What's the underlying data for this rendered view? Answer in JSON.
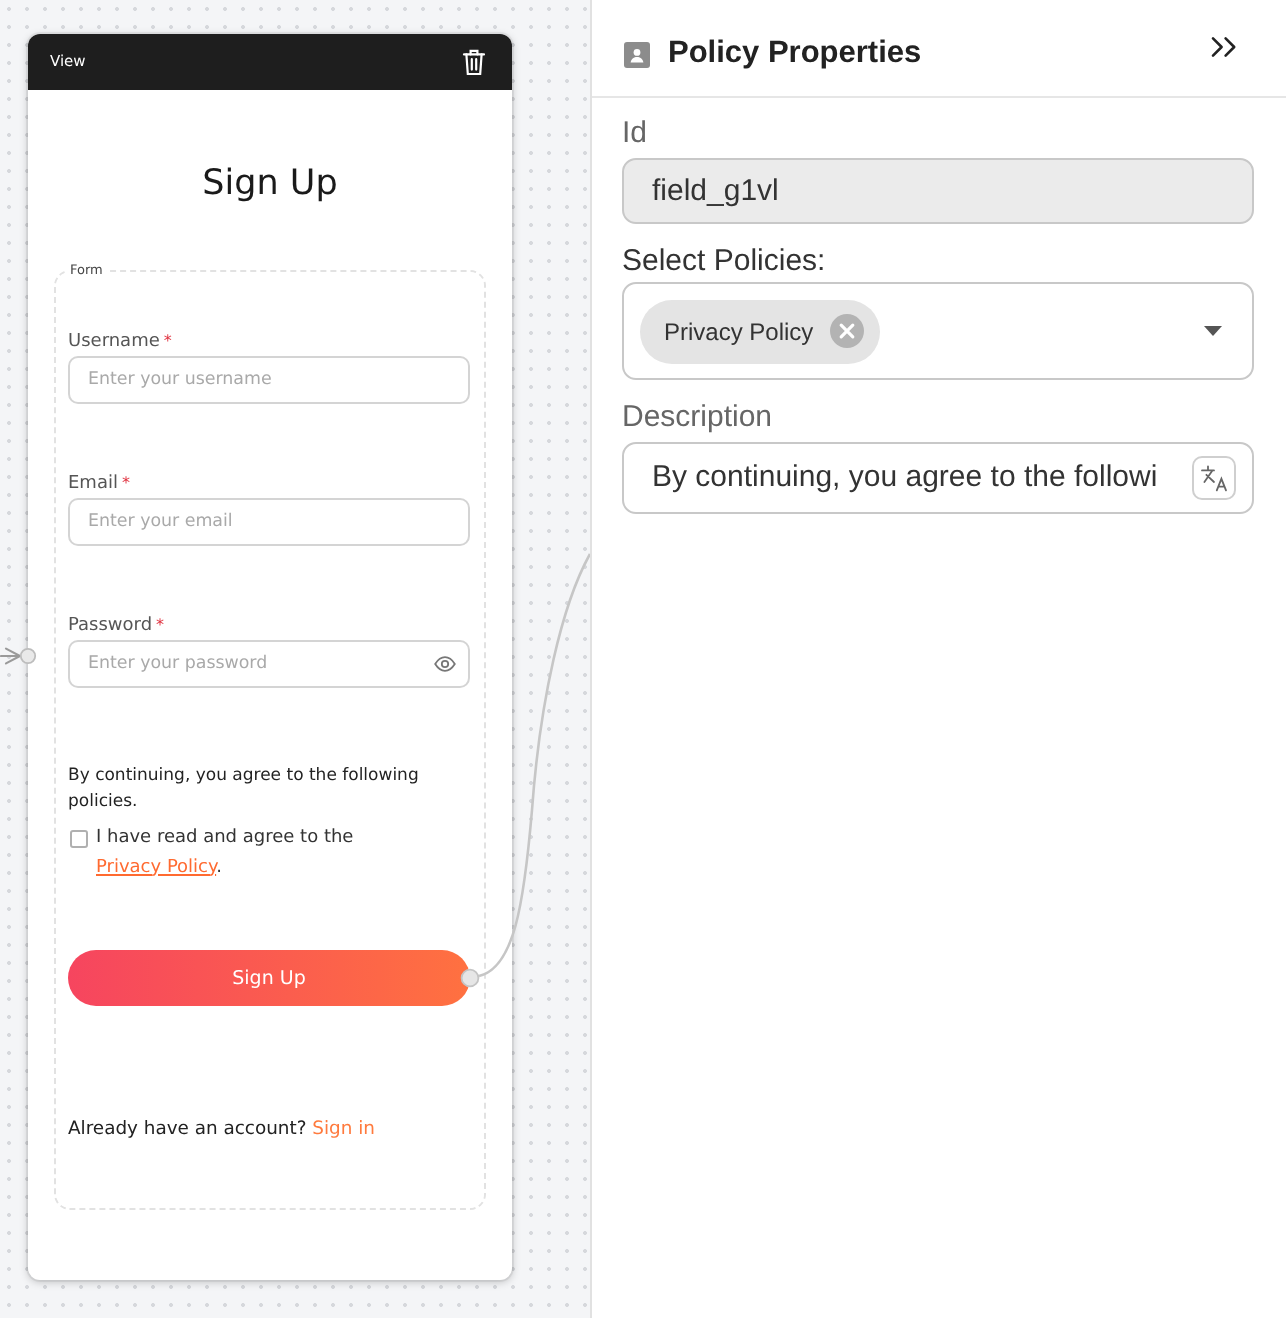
{
  "canvas": {
    "view_node": {
      "header": {
        "title": "View"
      },
      "title": "Sign Up",
      "form": {
        "legend": "Form",
        "fields": [
          {
            "kind": "text",
            "label": "Username",
            "required_mark": "*",
            "placeholder": "Enter your username"
          },
          {
            "kind": "email",
            "label": "Email",
            "required_mark": "*",
            "placeholder": "Enter your email"
          },
          {
            "kind": "password",
            "label": "Password",
            "required_mark": "*",
            "placeholder": "Enter your password"
          }
        ],
        "consent": {
          "text": "By continuing, you agree to the following policies.",
          "checkbox": {
            "checked": false,
            "text": "I have read and agree to the",
            "link": "Privacy Policy",
            "after": "."
          }
        },
        "submit_button": "Sign Up",
        "footer": {
          "text": "Already have an account?",
          "link": "Sign in"
        }
      }
    }
  },
  "properties_panel": {
    "title": "Policy Properties",
    "fields": [
      {
        "kind": "text",
        "label": "Id",
        "value": "field_g1vl",
        "disabled": true,
        "translatable": false
      },
      {
        "kind": "multiselect",
        "label": "Select Policies:",
        "disabled": false,
        "chips": [
          {
            "label": "Privacy Policy"
          }
        ]
      },
      {
        "kind": "text",
        "label": "Description",
        "value": "By continuing, you agree to the followi",
        "disabled": false,
        "translatable": true
      }
    ]
  }
}
